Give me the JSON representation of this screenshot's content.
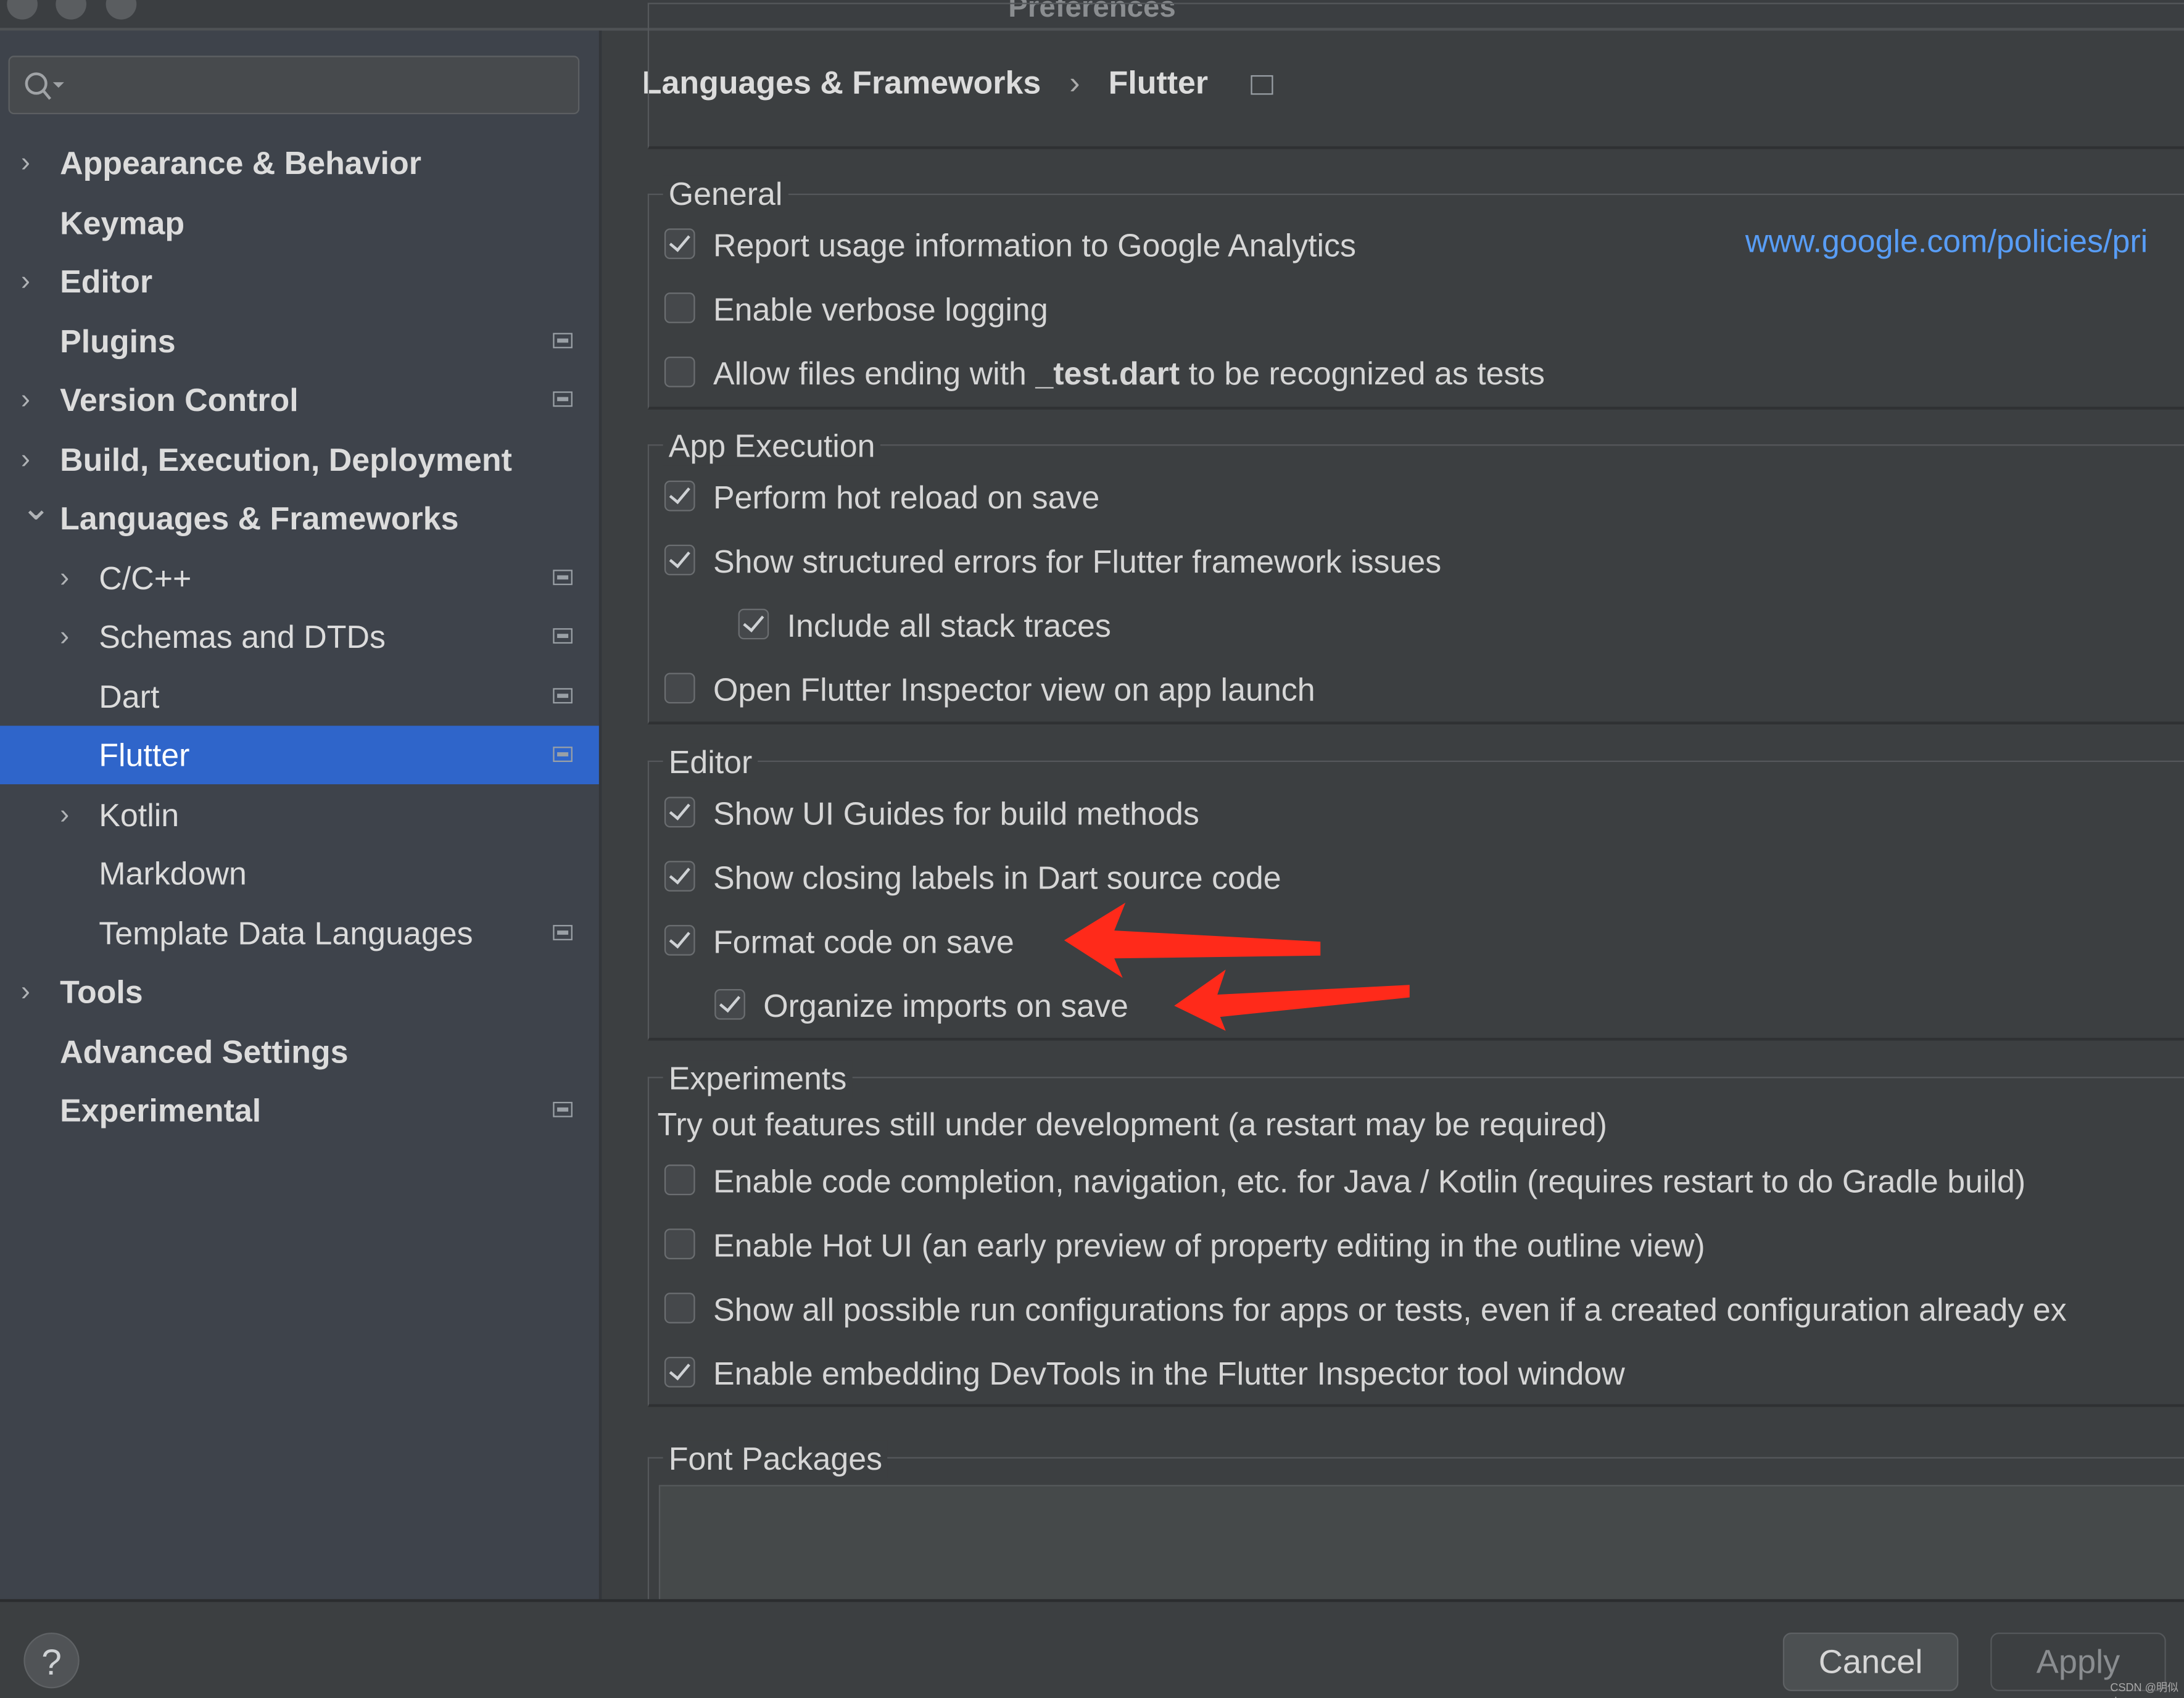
{
  "window": {
    "title": "Preferences"
  },
  "search": {
    "placeholder": ""
  },
  "sidebar": {
    "items": [
      {
        "label": "Appearance & Behavior",
        "level": 0,
        "expandable": true,
        "expanded": false,
        "bold": true,
        "project": false
      },
      {
        "label": "Keymap",
        "level": 0,
        "expandable": false,
        "bold": true,
        "project": false
      },
      {
        "label": "Editor",
        "level": 0,
        "expandable": true,
        "expanded": false,
        "bold": true,
        "project": false
      },
      {
        "label": "Plugins",
        "level": 0,
        "expandable": false,
        "bold": true,
        "project": true
      },
      {
        "label": "Version Control",
        "level": 0,
        "expandable": true,
        "expanded": false,
        "bold": true,
        "project": true
      },
      {
        "label": "Build, Execution, Deployment",
        "level": 0,
        "expandable": true,
        "expanded": false,
        "bold": true,
        "project": false
      },
      {
        "label": "Languages & Frameworks",
        "level": 0,
        "expandable": true,
        "expanded": true,
        "bold": true,
        "project": false
      },
      {
        "label": "C/C++",
        "level": 1,
        "expandable": true,
        "expanded": false,
        "bold": false,
        "project": true
      },
      {
        "label": "Schemas and DTDs",
        "level": 1,
        "expandable": true,
        "expanded": false,
        "bold": false,
        "project": true
      },
      {
        "label": "Dart",
        "level": 1,
        "expandable": false,
        "bold": false,
        "project": true
      },
      {
        "label": "Flutter",
        "level": 1,
        "expandable": false,
        "bold": false,
        "project": true,
        "selected": true
      },
      {
        "label": "Kotlin",
        "level": 1,
        "expandable": true,
        "expanded": false,
        "bold": false,
        "project": false
      },
      {
        "label": "Markdown",
        "level": 1,
        "expandable": false,
        "bold": false,
        "project": false
      },
      {
        "label": "Template Data Languages",
        "level": 1,
        "expandable": false,
        "bold": false,
        "project": true
      },
      {
        "label": "Tools",
        "level": 0,
        "expandable": true,
        "expanded": false,
        "bold": true,
        "project": false
      },
      {
        "label": "Advanced Settings",
        "level": 0,
        "expandable": false,
        "bold": true,
        "project": false
      },
      {
        "label": "Experimental",
        "level": 0,
        "expandable": false,
        "bold": true,
        "project": true
      }
    ]
  },
  "breadcrumb": {
    "parent": "Languages & Frameworks",
    "separator": "›",
    "current": "Flutter"
  },
  "general": {
    "title": "General",
    "link": "www.google.com/policies/pri",
    "items": [
      {
        "label": "Report usage information to Google Analytics",
        "checked": true,
        "indent": 0
      },
      {
        "label": "Enable verbose logging",
        "checked": false,
        "indent": 0
      },
      {
        "label_pre": "Allow files ending with ",
        "label_bold": "_test.dart",
        "label": " to be recognized as tests",
        "checked": false,
        "indent": 0
      }
    ]
  },
  "app_execution": {
    "title": "App Execution",
    "items": [
      {
        "label": "Perform hot reload on save",
        "checked": true,
        "indent": 0
      },
      {
        "label": "Show structured errors for Flutter framework issues",
        "checked": true,
        "indent": 0
      },
      {
        "label": "Include all stack traces",
        "checked": true,
        "indent": 2
      },
      {
        "label": "Open Flutter Inspector view on app launch",
        "checked": false,
        "indent": 0
      }
    ]
  },
  "editor": {
    "title": "Editor",
    "items": [
      {
        "label": "Show UI Guides for build methods",
        "checked": true,
        "indent": 0
      },
      {
        "label": "Show closing labels in Dart source code",
        "checked": true,
        "indent": 0
      },
      {
        "label": "Format code on save",
        "checked": true,
        "indent": 0
      },
      {
        "label": "Organize imports on save",
        "checked": true,
        "indent": 1
      }
    ]
  },
  "experiments": {
    "title": "Experiments",
    "description": "Try out features still under development (a restart may be required)",
    "items": [
      {
        "label": "Enable code completion, navigation, etc. for Java / Kotlin (requires restart to do Gradle build)",
        "checked": false,
        "indent": 0
      },
      {
        "label": "Enable Hot UI (an early preview of property editing in the outline view)",
        "checked": false,
        "indent": 0
      },
      {
        "label": "Show all possible run configurations for apps or tests, even if a created configuration already ex",
        "checked": false,
        "indent": 0
      },
      {
        "label": "Enable embedding DevTools in the Flutter Inspector tool window",
        "checked": true,
        "indent": 0
      }
    ]
  },
  "font_packages": {
    "title": "Font Packages"
  },
  "footer": {
    "help": "?",
    "cancel": "Cancel",
    "apply": "Apply"
  },
  "watermark": "CSDN @明似水",
  "colors": {
    "selection": "#2f65ca",
    "link": "#589df6",
    "annotation_arrow": "#ff2a1a"
  }
}
